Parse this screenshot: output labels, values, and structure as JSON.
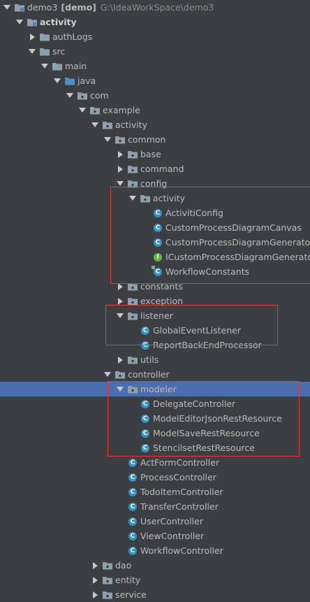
{
  "project": {
    "name": "demo3",
    "module": "[demo]",
    "path": "G:\\IdeaWorkSpace\\demo3"
  },
  "tree": [
    {
      "label": "activity",
      "icon": "module-folder-icon",
      "expanded": true,
      "bold": true
    },
    {
      "label": "authLogs",
      "icon": "folder-icon",
      "expanded": false
    },
    {
      "label": "src",
      "icon": "folder-icon",
      "expanded": true
    },
    {
      "label": "main",
      "icon": "folder-icon",
      "expanded": true
    },
    {
      "label": "java",
      "icon": "source-root-folder-icon",
      "expanded": true
    },
    {
      "label": "com",
      "icon": "package-icon",
      "expanded": true
    },
    {
      "label": "example",
      "icon": "package-icon",
      "expanded": true
    },
    {
      "label": "activity",
      "icon": "package-icon",
      "expanded": true
    },
    {
      "label": "common",
      "icon": "package-icon",
      "expanded": true
    },
    {
      "label": "base",
      "icon": "package-icon",
      "expanded": false
    },
    {
      "label": "command",
      "icon": "package-icon",
      "expanded": false
    },
    {
      "label": "config",
      "icon": "package-icon",
      "expanded": true
    },
    {
      "label": "activity",
      "icon": "package-icon",
      "expanded": true
    },
    {
      "label": "ActivitiConfig",
      "icon": "class-icon"
    },
    {
      "label": "CustomProcessDiagramCanvas",
      "icon": "class-icon"
    },
    {
      "label": "CustomProcessDiagramGenerator",
      "icon": "class-icon"
    },
    {
      "label": "ICustomProcessDiagramGenerator",
      "icon": "interface-icon"
    },
    {
      "label": "WorkflowConstants",
      "icon": "class-icon"
    },
    {
      "label": "constants",
      "icon": "package-icon",
      "expanded": false
    },
    {
      "label": "exception",
      "icon": "package-icon",
      "expanded": false
    },
    {
      "label": "listener",
      "icon": "package-icon",
      "expanded": true
    },
    {
      "label": "GlobalEventListener",
      "icon": "class-icon"
    },
    {
      "label": "ReportBackEndProcessor",
      "icon": "class-icon"
    },
    {
      "label": "utils",
      "icon": "package-icon",
      "expanded": false
    },
    {
      "label": "controller",
      "icon": "package-icon",
      "expanded": true
    },
    {
      "label": "modeler",
      "icon": "package-icon",
      "expanded": true,
      "selected": true
    },
    {
      "label": "DelegateController",
      "icon": "class-icon"
    },
    {
      "label": "ModelEditorJsonRestResource",
      "icon": "class-icon"
    },
    {
      "label": "ModelSaveRestResource",
      "icon": "class-icon"
    },
    {
      "label": "StencilsetRestResource",
      "icon": "class-icon"
    },
    {
      "label": "ActFormController",
      "icon": "class-icon"
    },
    {
      "label": "ProcessController",
      "icon": "class-icon"
    },
    {
      "label": "TodoItemController",
      "icon": "class-icon"
    },
    {
      "label": "TransferController",
      "icon": "class-icon"
    },
    {
      "label": "UserController",
      "icon": "class-icon"
    },
    {
      "label": "ViewController",
      "icon": "class-icon"
    },
    {
      "label": "WorkflowController",
      "icon": "class-icon"
    },
    {
      "label": "dao",
      "icon": "package-icon",
      "expanded": false
    },
    {
      "label": "entity",
      "icon": "package-icon",
      "expanded": false
    },
    {
      "label": "service",
      "icon": "package-icon",
      "expanded": false
    }
  ],
  "colors": {
    "background": "#3c3f41",
    "selection": "#4b6eaf",
    "text": "#bbbbbb",
    "class_icon": "#3592c4",
    "interface_icon": "#62b543",
    "highlight_box": "#e53935"
  }
}
